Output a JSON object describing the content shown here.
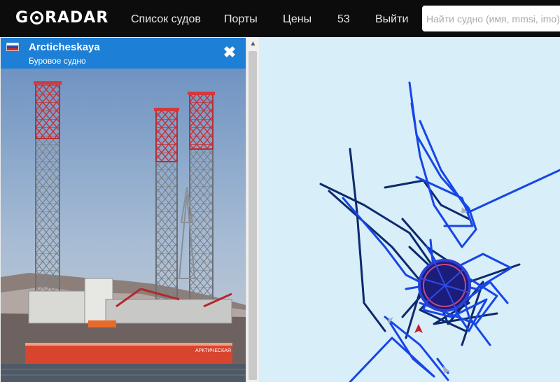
{
  "navbar": {
    "logo": "GORADAR",
    "items": [
      {
        "label": "Список судов"
      },
      {
        "label": "Порты"
      },
      {
        "label": "Цены"
      },
      {
        "label": "53"
      },
      {
        "label": "Выйти"
      }
    ],
    "search": {
      "placeholder": "Найти судно (имя, mmsi, imo)",
      "value": ""
    }
  },
  "vessel": {
    "name": "Arcticheskaya",
    "type": "Буровое судно",
    "flag": "russia-flag-icon",
    "hull_lettering": "АРКТИЧЕСКАЯ"
  },
  "icons": {
    "close": "close-icon",
    "scroll_up": "chevron-up-icon",
    "vessel_marker": "vessel-marker-icon"
  },
  "colors": {
    "navbar_bg": "#0c0c0c",
    "panel_header": "#1d7fd6",
    "map_water": "#d8eef8",
    "track_bright": "#1746e6",
    "track_dark": "#0e2a6e",
    "marker": "#c0202a"
  }
}
